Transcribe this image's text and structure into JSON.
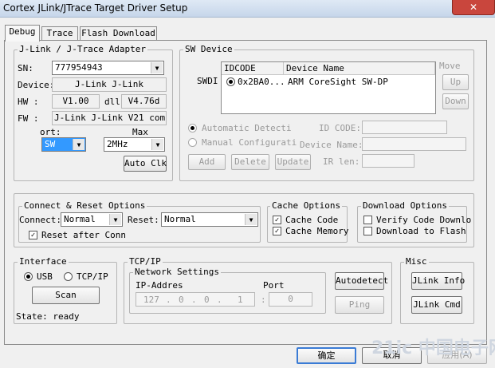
{
  "window": {
    "title": "Cortex JLink/JTrace Target Driver Setup",
    "close_glyph": "✕"
  },
  "tabs": [
    {
      "label": "Debug"
    },
    {
      "label": "Trace"
    },
    {
      "label": "Flash Download"
    }
  ],
  "adapter": {
    "group_title": "J-Link / J-Trace Adapter",
    "sn_label": "SN:",
    "sn_value": "777954943",
    "device_label": "Device:",
    "device_value": "J-Link J-Link",
    "hw_label": "HW :",
    "hw_value": "V1.00",
    "dll_label": "dll",
    "dll_value": "V4.76d",
    "fw_label": "FW :",
    "fw_value": "J-Link J-Link V21 compi",
    "port_label": "ort:",
    "port_value": "SW",
    "max_label": "Max",
    "max_value": "2MHz",
    "auto_clk_label": "Auto Clk"
  },
  "sw_device": {
    "group_title": "SW Device",
    "row_label": "SWDI",
    "col_idcode": "IDCODE",
    "col_device_name": "Device Name",
    "row_idcode": "0x2BA0...",
    "row_device_name": "ARM CoreSight SW-DP",
    "move_label": "Move",
    "up_label": "Up",
    "down_label": "Down",
    "auto_detect_label": "Automatic Detecti",
    "manual_config_label": "Manual Configurati",
    "id_code_label": "ID CODE:",
    "device_name_label": "Device Name:",
    "ir_len_label": "IR len:",
    "add_label": "Add",
    "delete_label": "Delete",
    "update_label": "Update"
  },
  "connect_reset": {
    "group_title": "Connect & Reset Options",
    "connect_label": "Connect:",
    "connect_value": "Normal",
    "reset_label": "Reset:",
    "reset_value": "Normal",
    "reset_after_connect_label": "Reset after Conn"
  },
  "cache": {
    "group_title": "Cache Options",
    "cache_code_label": "Cache Code",
    "cache_memory_label": "Cache Memory"
  },
  "download": {
    "group_title": "Download Options",
    "verify_label": "Verify Code Downlo",
    "download_flash_label": "Download to Flash"
  },
  "interface": {
    "group_title": "Interface",
    "usb_label": "USB",
    "tcpip_label": "TCP/IP",
    "scan_label": "Scan",
    "state_text": "State: ready"
  },
  "tcpip": {
    "group_title": "TCP/IP",
    "network_settings_label": "Network Settings",
    "ip_label": "IP-Addres",
    "port_label": "Port",
    "ip_1": "127",
    "ip_2": "0",
    "ip_3": "0",
    "ip_4": "1",
    "ip_sep": ".",
    "port_sep": ":",
    "port_value": "0",
    "autodetect_label": "Autodetect",
    "ping_label": "Ping"
  },
  "misc": {
    "group_title": "Misc",
    "jlink_info_label": "JLink Info",
    "jlink_cmd_label": "JLink Cmd"
  },
  "footer": {
    "ok_label": "确定",
    "cancel_label": "取消",
    "apply_label": "应用(A)"
  },
  "watermark_text": "21ic 中国电子网"
}
